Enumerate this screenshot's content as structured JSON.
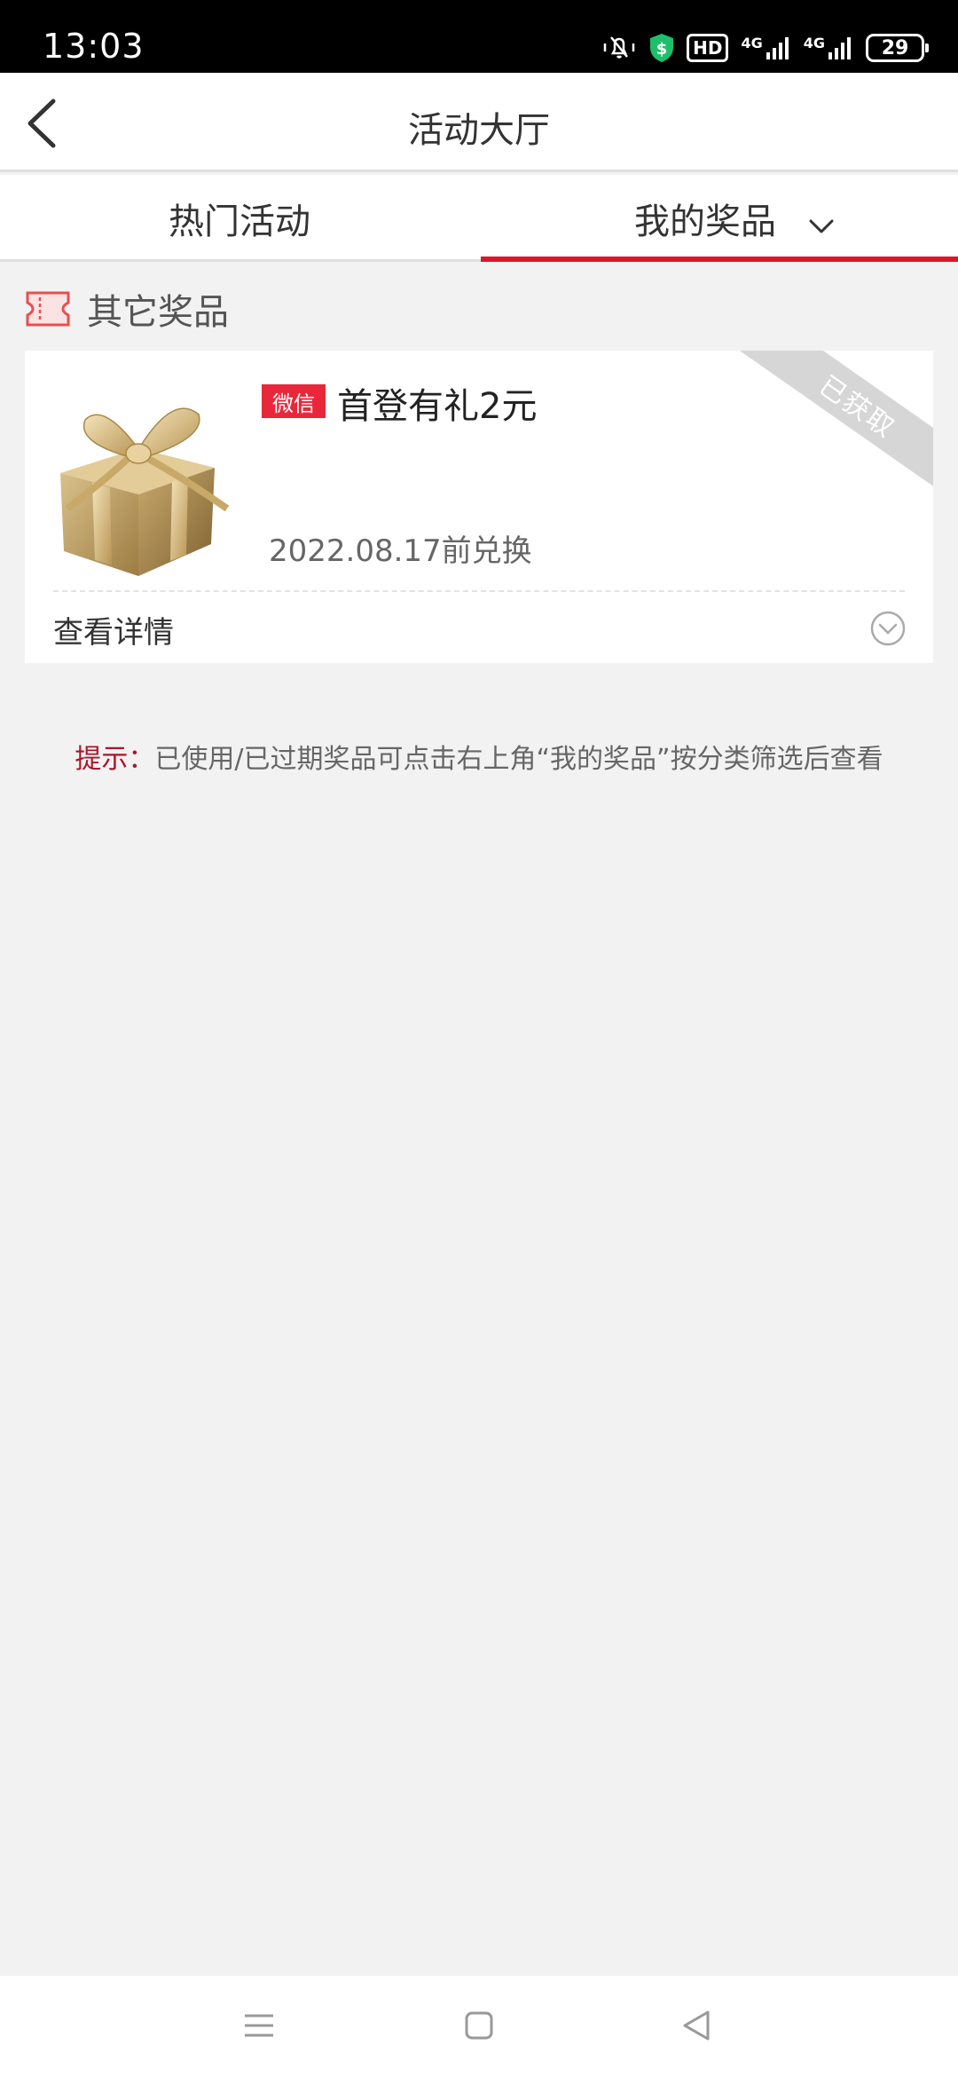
{
  "status_bar": {
    "time": "13:03",
    "hd_label": "HD",
    "sim1_label": "4G",
    "sim2_label": "4G",
    "battery_level": "29"
  },
  "header": {
    "title": "活动大厅"
  },
  "tabs": [
    {
      "label": "热门活动",
      "active": false
    },
    {
      "label": "我的奖品",
      "active": true
    }
  ],
  "section": {
    "title": "其它奖品"
  },
  "prize": {
    "source": "微信",
    "title": "首登有礼2元",
    "expiry": "2022.08.17前兑换",
    "status": "已获取",
    "detail_label": "查看详情"
  },
  "hint": {
    "label": "提示：",
    "text": "已使用/已过期奖品可点击右上角“我的奖品”按分类筛选后查看"
  },
  "colors": {
    "accent": "#d8182a",
    "badge": "#e8283a",
    "hint_label": "#a8162a",
    "background": "#f2f2f2"
  }
}
